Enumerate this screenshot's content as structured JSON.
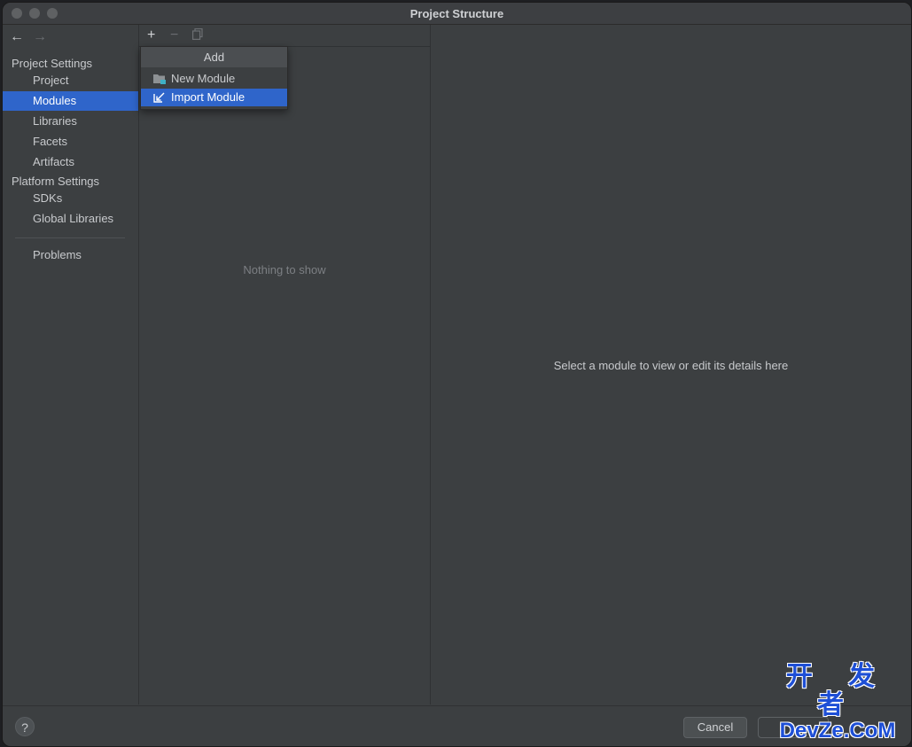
{
  "window": {
    "title": "Project Structure"
  },
  "sidebar": {
    "project_settings_header": "Project Settings",
    "project_items": [
      {
        "label": "Project"
      },
      {
        "label": "Modules",
        "selected": true
      },
      {
        "label": "Libraries"
      },
      {
        "label": "Facets"
      },
      {
        "label": "Artifacts"
      }
    ],
    "platform_settings_header": "Platform Settings",
    "platform_items": [
      {
        "label": "SDKs"
      },
      {
        "label": "Global Libraries"
      }
    ],
    "problems_label": "Problems"
  },
  "toolbar": {
    "add_icon": "plus-icon",
    "remove_icon": "minus-icon",
    "copy_icon": "copy-icon"
  },
  "popup": {
    "title": "Add",
    "items": [
      {
        "label": "New Module",
        "icon": "folder-module-icon"
      },
      {
        "label": "Import Module",
        "icon": "import-arrow-icon",
        "selected": true
      }
    ]
  },
  "modules_list": {
    "empty_text": "Nothing to show"
  },
  "details": {
    "placeholder": "Select a module to view or edit its details here"
  },
  "footer": {
    "help_label": "?",
    "cancel_label": "Cancel"
  },
  "watermark": {
    "line1": "开 发 者",
    "line2": "DevZe.CoM"
  },
  "colors": {
    "accent": "#2f65ca",
    "background": "#3c3f41",
    "text": "#c8cacd",
    "watermark": "#1e4fd6"
  }
}
